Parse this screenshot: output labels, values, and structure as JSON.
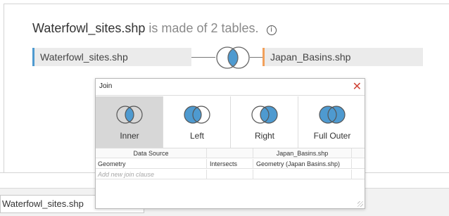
{
  "header": {
    "table_name": "Waterfowl_sites.shp",
    "suffix": "is made of 2 tables.",
    "info_icon": "info-icon",
    "info_glyph": "i"
  },
  "canvas": {
    "left_table": "Waterfowl_sites.shp",
    "right_table": "Japan_Basins.shp",
    "join_icon": "inner-join-venn-icon",
    "colors": {
      "left": "#4e9ad0",
      "right": "#f2a05a",
      "venn_fill": "#4e9ad0"
    }
  },
  "dialog": {
    "title": "Join",
    "close_glyph": "✕",
    "join_types": [
      {
        "label": "Inner",
        "icon": "inner-join-icon",
        "selected": true
      },
      {
        "label": "Left",
        "icon": "left-join-icon",
        "selected": false
      },
      {
        "label": "Right",
        "icon": "right-join-icon",
        "selected": false
      },
      {
        "label": "Full Outer",
        "icon": "full-outer-join-icon",
        "selected": false
      }
    ],
    "table": {
      "headers": [
        "Data Source",
        "",
        "Japan_Basins.shp",
        ""
      ],
      "rows": [
        [
          "Geometry",
          "Intersects",
          "Geometry (Japan Basins.shp)",
          ""
        ]
      ],
      "add_placeholder": "Add new join clause"
    }
  },
  "bottom": {
    "tab_label": "Waterfowl_sites.shp"
  }
}
